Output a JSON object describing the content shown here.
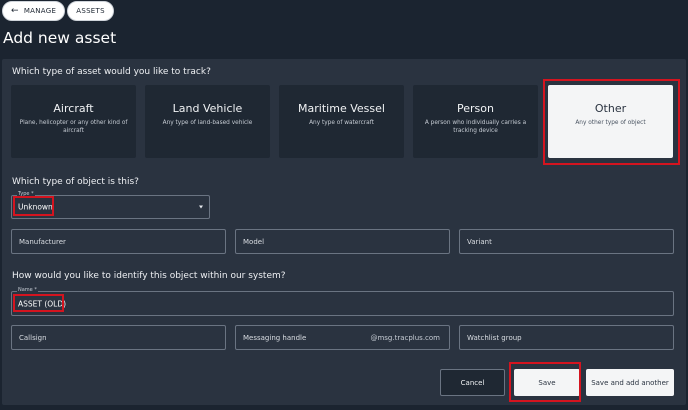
{
  "breadcrumb": {
    "manage": "MANAGE",
    "assets": "ASSETS"
  },
  "page_title": "Add new asset",
  "section_type": {
    "question": "Which type of asset would you like to track?",
    "cards": [
      {
        "title": "Aircraft",
        "desc": "Plane, helicopter or any other kind of aircraft",
        "selected": false
      },
      {
        "title": "Land Vehicle",
        "desc": "Any type of land-based vehicle",
        "selected": false
      },
      {
        "title": "Maritime Vessel",
        "desc": "Any type of watercraft",
        "selected": false
      },
      {
        "title": "Person",
        "desc": "A person who individually carries a tracking device",
        "selected": false
      },
      {
        "title": "Other",
        "desc": "Any other type of object",
        "selected": true
      }
    ]
  },
  "section_object": {
    "question": "Which type of object is this?",
    "type_label": "Type *",
    "type_value": "Unknown",
    "manufacturer": "Manufacturer",
    "model": "Model",
    "variant": "Variant"
  },
  "section_identify": {
    "question": "How would you like to identify this object within our system?",
    "name_label": "Name *",
    "name_value": "ASSET (OLD)",
    "callsign": "Callsign",
    "messaging_handle": "Messaging handle",
    "messaging_suffix": "@msg.tracplus.com",
    "watchlist": "Watchlist group"
  },
  "actions": {
    "cancel": "Cancel",
    "save": "Save",
    "save_and_add": "Save and add another"
  },
  "colors": {
    "background": "#1b2430",
    "panel": "#2a3340",
    "card": "#1f2833",
    "highlight": "#d4141f"
  }
}
